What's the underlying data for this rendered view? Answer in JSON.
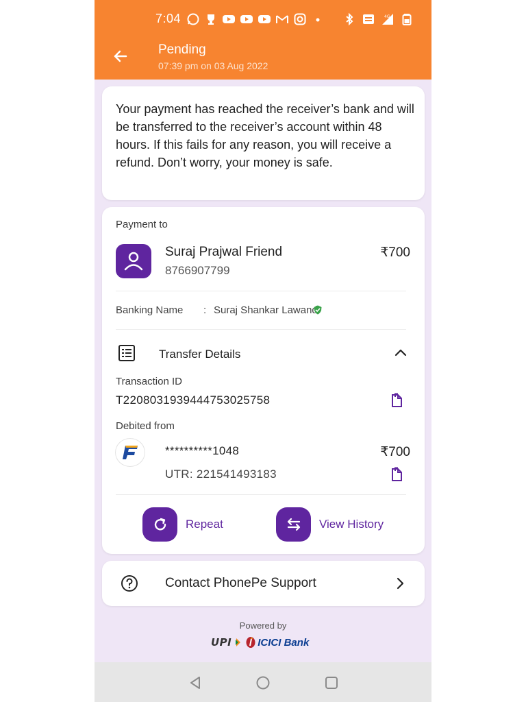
{
  "status_bar": {
    "time": "7:04",
    "left_icons": [
      "whatsapp-icon",
      "trophy-icon",
      "youtube-icon",
      "youtube-icon",
      "youtube-icon",
      "gmail-icon",
      "instagram-icon",
      "dot-icon"
    ],
    "right_icons": [
      "bluetooth-icon",
      "volte-icon",
      "signal-4g-icon",
      "battery-icon"
    ],
    "network_label": "4G"
  },
  "header": {
    "title": "Pending",
    "subtitle": "07:39 pm on 03 Aug 2022",
    "background": "#f78430"
  },
  "message": {
    "text": "Your payment has reached the receiver’s bank and will be transferred to the receiver’s account within 48 hours. If this fails for any reason, you will receive a refund. Don’t worry, your money is safe."
  },
  "payment": {
    "label": "Payment to",
    "payee_name": "Suraj Prajwal Friend",
    "payee_phone": "8766907799",
    "amount": "₹700",
    "banking_name_label": "Banking Name",
    "banking_name_sep": ":",
    "banking_name": "Suraj Shankar Lawand"
  },
  "transfer": {
    "title": "Transfer Details",
    "transaction_id_label": "Transaction ID",
    "transaction_id": "T2208031939444753025758",
    "debited_label": "Debited from",
    "account_masked": "**********1048",
    "debit_amount": "₹700",
    "utr": "UTR: 221541493183"
  },
  "actions": {
    "repeat": "Repeat",
    "view_history": "View History"
  },
  "support": {
    "label": "Contact PhonePe Support"
  },
  "footer": {
    "powered_by": "Powered by",
    "upi": "UPI",
    "bank": "ICICI Bank"
  },
  "colors": {
    "brand_purple": "#5f259f",
    "header_orange": "#f78430",
    "page_bg": "#efe6f6",
    "verified_green": "#3aa34a"
  }
}
